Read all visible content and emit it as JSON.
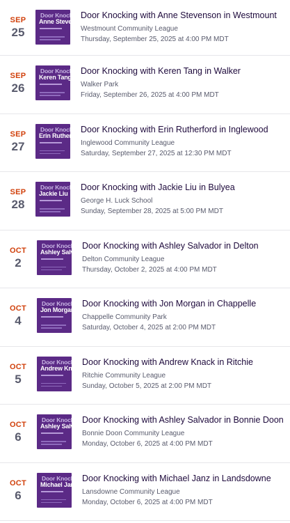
{
  "colors": {
    "month_accent": "#d1410c",
    "thumbnail_bg": "#5b2a86",
    "title_text": "#1e0a3c",
    "meta_text": "#585a6c"
  },
  "thumbnail": {
    "line1": "Door Knocking"
  },
  "events": [
    {
      "month": "SEP",
      "day": "25",
      "title": "Door Knocking with Anne Stevenson in Westmount",
      "venue": "Westmount Community League",
      "datetime": "Thursday, September 25, 2025 at 4:00 PM MDT",
      "thumb_name": "Anne Stevenson"
    },
    {
      "month": "SEP",
      "day": "26",
      "title": "Door Knocking with Keren Tang in Walker",
      "venue": "Walker Park",
      "datetime": "Friday, September 26, 2025 at 4:00 PM MDT",
      "thumb_name": "Keren Tang"
    },
    {
      "month": "SEP",
      "day": "27",
      "title": "Door Knocking with Erin Rutherford in Inglewood",
      "venue": "Inglewood Community League",
      "datetime": "Saturday, September 27, 2025 at 12:30 PM MDT",
      "thumb_name": "Erin Rutherford"
    },
    {
      "month": "SEP",
      "day": "28",
      "title": "Door Knocking with Jackie Liu in Bulyea",
      "venue": "George H. Luck School",
      "datetime": "Sunday, September 28, 2025 at 5:00 PM MDT",
      "thumb_name": "Jackie Liu"
    },
    {
      "month": "OCT",
      "day": "2",
      "title": "Door Knocking with Ashley Salvador in Delton",
      "venue": "Delton Community League",
      "datetime": "Thursday, October 2, 2025 at 4:00 PM MDT",
      "thumb_name": "Ashley Salvador"
    },
    {
      "month": "OCT",
      "day": "4",
      "title": "Door Knocking with Jon Morgan in Chappelle",
      "venue": "Chappelle Community Park",
      "datetime": "Saturday, October 4, 2025 at 2:00 PM MDT",
      "thumb_name": "Jon Morgan"
    },
    {
      "month": "OCT",
      "day": "5",
      "title": "Door Knocking with Andrew Knack in Ritchie",
      "venue": "Ritchie Community League",
      "datetime": "Sunday, October 5, 2025 at 2:00 PM MDT",
      "thumb_name": "Andrew Knack"
    },
    {
      "month": "OCT",
      "day": "6",
      "title": "Door Knocking with Ashley Salvador in Bonnie Doon",
      "venue": "Bonnie Doon Community League",
      "datetime": "Monday, October 6, 2025 at 4:00 PM MDT",
      "thumb_name": "Ashley Salvador"
    },
    {
      "month": "OCT",
      "day": "6",
      "title": "Door Knocking with Michael Janz in Landsdowne",
      "venue": "Lansdowne Community League",
      "datetime": "Monday, October 6, 2025 at 4:00 PM MDT",
      "thumb_name": "Michael Janz"
    }
  ]
}
